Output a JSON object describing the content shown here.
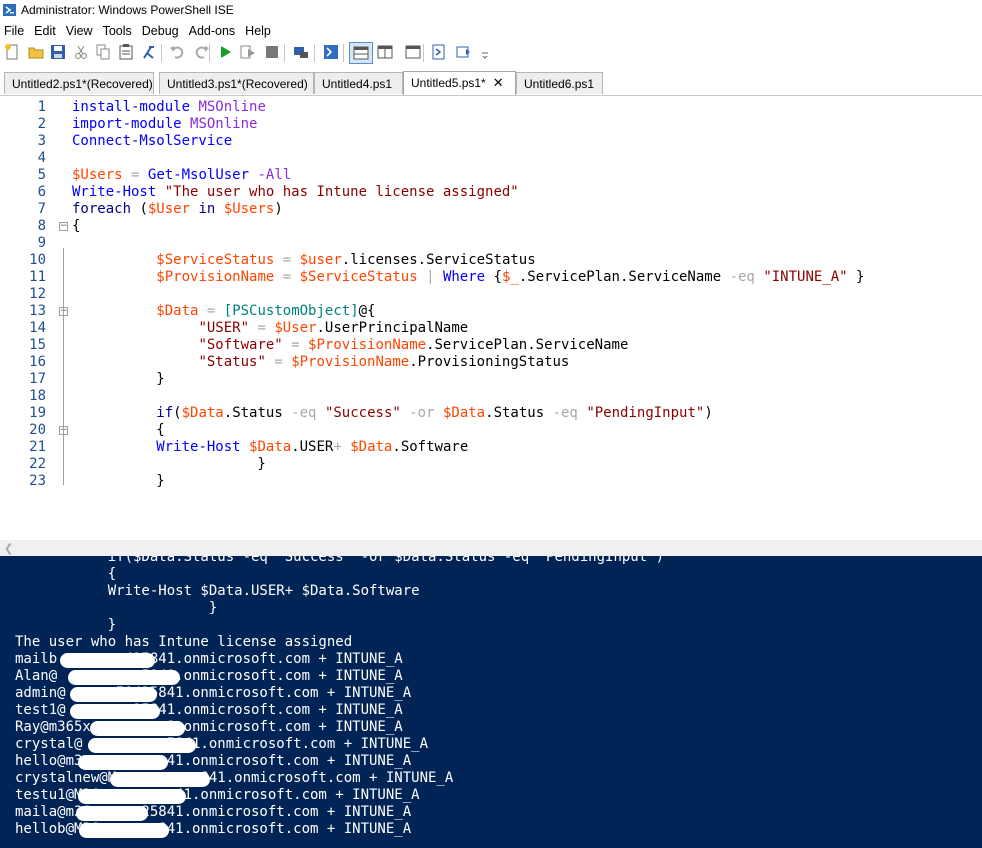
{
  "window": {
    "title": "Administrator: Windows PowerShell ISE"
  },
  "menu": [
    "File",
    "Edit",
    "View",
    "Tools",
    "Debug",
    "Add-ons",
    "Help"
  ],
  "toolbar": [
    {
      "name": "new-file-icon"
    },
    {
      "name": "open-folder-icon"
    },
    {
      "name": "save-icon"
    },
    {
      "name": "cut-icon"
    },
    {
      "name": "copy-icon"
    },
    {
      "name": "paste-icon"
    },
    {
      "name": "clear-console-icon"
    },
    {
      "name": "undo-icon"
    },
    {
      "name": "redo-icon"
    },
    {
      "name": "run-icon"
    },
    {
      "name": "run-selection-icon"
    },
    {
      "name": "stop-icon"
    },
    {
      "name": "remote-powershell-icon"
    },
    {
      "name": "powershell-console-icon"
    },
    {
      "name": "layout-top-icon"
    },
    {
      "name": "layout-right-icon"
    },
    {
      "name": "layout-max-icon"
    },
    {
      "name": "commands-icon"
    },
    {
      "name": "addons-icon"
    },
    {
      "name": "more-icon"
    }
  ],
  "tabs": [
    {
      "label": "Untitled2.ps1*(Recovered)",
      "active": false
    },
    {
      "label": "Untitled3.ps1*(Recovered)",
      "active": false
    },
    {
      "label": "Untitled4.ps1",
      "active": false
    },
    {
      "label": "Untitled5.ps1*",
      "active": true,
      "close": "✕"
    },
    {
      "label": "Untitled6.ps1",
      "active": false
    }
  ],
  "editor": {
    "lines": [
      [
        [
          "cmd",
          "install-module"
        ],
        [
          "t",
          " "
        ],
        [
          "arg",
          "MSOnline"
        ]
      ],
      [
        [
          "cmd",
          "import-module"
        ],
        [
          "t",
          " "
        ],
        [
          "arg",
          "MSOnline"
        ]
      ],
      [
        [
          "cmd",
          "Connect-MsolService"
        ]
      ],
      [],
      [
        [
          "var",
          "$Users"
        ],
        [
          "t",
          " "
        ],
        [
          "op",
          "="
        ],
        [
          "t",
          " "
        ],
        [
          "cmd",
          "Get-MsolUser"
        ],
        [
          "t",
          " "
        ],
        [
          "arg",
          "-All"
        ]
      ],
      [
        [
          "cmd",
          "Write-Host"
        ],
        [
          "t",
          " "
        ],
        [
          "str",
          "\"The user who has Intune license assigned\""
        ]
      ],
      [
        [
          "kw",
          "foreach"
        ],
        [
          "t",
          " ("
        ],
        [
          "var",
          "$User"
        ],
        [
          "t",
          " "
        ],
        [
          "kw",
          "in"
        ],
        [
          "t",
          " "
        ],
        [
          "var",
          "$Users"
        ],
        [
          "t",
          ")"
        ]
      ],
      [
        [
          "t",
          "{"
        ]
      ],
      [],
      [
        [
          "t",
          "          "
        ],
        [
          "var",
          "$ServiceStatus"
        ],
        [
          "t",
          " "
        ],
        [
          "op",
          "="
        ],
        [
          "t",
          " "
        ],
        [
          "var",
          "$user"
        ],
        [
          "t",
          "."
        ],
        [
          "prop",
          "licenses"
        ],
        [
          "t",
          "."
        ],
        [
          "prop",
          "ServiceStatus"
        ]
      ],
      [
        [
          "t",
          "          "
        ],
        [
          "var",
          "$ProvisionName"
        ],
        [
          "t",
          " "
        ],
        [
          "op",
          "="
        ],
        [
          "t",
          " "
        ],
        [
          "var",
          "$ServiceStatus"
        ],
        [
          "t",
          " "
        ],
        [
          "op",
          "|"
        ],
        [
          "t",
          " "
        ],
        [
          "cmd",
          "Where"
        ],
        [
          "t",
          " {"
        ],
        [
          "var",
          "$_"
        ],
        [
          "t",
          "."
        ],
        [
          "prop",
          "ServicePlan"
        ],
        [
          "t",
          "."
        ],
        [
          "prop",
          "ServiceName"
        ],
        [
          "t",
          " "
        ],
        [
          "op",
          "-eq"
        ],
        [
          "t",
          " "
        ],
        [
          "str",
          "\"INTUNE_A\""
        ],
        [
          "t",
          " }"
        ]
      ],
      [],
      [
        [
          "t",
          "          "
        ],
        [
          "var",
          "$Data"
        ],
        [
          "t",
          " "
        ],
        [
          "op",
          "="
        ],
        [
          "t",
          " "
        ],
        [
          "typ",
          "[PSCustomObject]"
        ],
        [
          "t",
          "@{"
        ]
      ],
      [
        [
          "t",
          "               "
        ],
        [
          "str",
          "\"USER\""
        ],
        [
          "t",
          " "
        ],
        [
          "op",
          "="
        ],
        [
          "t",
          " "
        ],
        [
          "var",
          "$User"
        ],
        [
          "t",
          "."
        ],
        [
          "prop",
          "UserPrincipalName"
        ]
      ],
      [
        [
          "t",
          "               "
        ],
        [
          "str",
          "\"Software\""
        ],
        [
          "t",
          " "
        ],
        [
          "op",
          "="
        ],
        [
          "t",
          " "
        ],
        [
          "var",
          "$ProvisionName"
        ],
        [
          "t",
          "."
        ],
        [
          "prop",
          "ServicePlan"
        ],
        [
          "t",
          "."
        ],
        [
          "prop",
          "ServiceName"
        ]
      ],
      [
        [
          "t",
          "               "
        ],
        [
          "str",
          "\"Status\""
        ],
        [
          "t",
          " "
        ],
        [
          "op",
          "="
        ],
        [
          "t",
          " "
        ],
        [
          "var",
          "$ProvisionName"
        ],
        [
          "t",
          "."
        ],
        [
          "prop",
          "ProvisioningStatus"
        ]
      ],
      [
        [
          "t",
          "          }"
        ]
      ],
      [],
      [
        [
          "t",
          "          "
        ],
        [
          "kw",
          "if"
        ],
        [
          "t",
          "("
        ],
        [
          "var",
          "$Data"
        ],
        [
          "t",
          "."
        ],
        [
          "prop",
          "Status"
        ],
        [
          "t",
          " "
        ],
        [
          "op",
          "-eq"
        ],
        [
          "t",
          " "
        ],
        [
          "str",
          "\"Success\""
        ],
        [
          "t",
          " "
        ],
        [
          "op",
          "-or"
        ],
        [
          "t",
          " "
        ],
        [
          "var",
          "$Data"
        ],
        [
          "t",
          "."
        ],
        [
          "prop",
          "Status"
        ],
        [
          "t",
          " "
        ],
        [
          "op",
          "-eq"
        ],
        [
          "t",
          " "
        ],
        [
          "str",
          "\"PendingInput\""
        ],
        [
          "t",
          ")"
        ]
      ],
      [
        [
          "t",
          "          {"
        ]
      ],
      [
        [
          "t",
          "          "
        ],
        [
          "cmd",
          "Write-Host"
        ],
        [
          "t",
          " "
        ],
        [
          "var",
          "$Data"
        ],
        [
          "t",
          "."
        ],
        [
          "prop",
          "USER"
        ],
        [
          "op",
          "+"
        ],
        [
          "t",
          " "
        ],
        [
          "var",
          "$Data"
        ],
        [
          "t",
          "."
        ],
        [
          "prop",
          "Software"
        ]
      ],
      [
        [
          "t",
          "                      }"
        ]
      ],
      [
        [
          "t",
          "          }"
        ]
      ]
    ]
  },
  "console": {
    "lines": [
      "           if($Data.Status -eq \"Success\" -or $Data.Status -eq \"PendingInput\")",
      "           {",
      "           Write-Host $Data.USER+ $Data.Software",
      "                       }",
      "           }",
      "The user who has Intune license assigned",
      "mailb        425841.onmicrosoft.com + INTUNE_A",
      "Alan@          5841.onmicrosoft.com + INTUNE_A",
      "admin@      71425841.onmicrosoft.com + INTUNE_A",
      "test1@        25841.onmicrosoft.com + INTUNE_A",
      "Ray@m365x         1.onmicrosoft.com + INTUNE_A",
      "crystal@          5841.onmicrosoft.com + INTUNE_A",
      "hello@m3          41.onmicrosoft.com + INTUNE_A",
      "crystalnew@M          841.onmicrosoft.com + INTUNE_A",
      "testu1@M36         41.onmicrosoft.com + INTUNE_A",
      "maila@m36      25841.onmicrosoft.com + INTUNE_A",
      "hellob@M36       841.onmicrosoft.com + INTUNE_A"
    ]
  }
}
